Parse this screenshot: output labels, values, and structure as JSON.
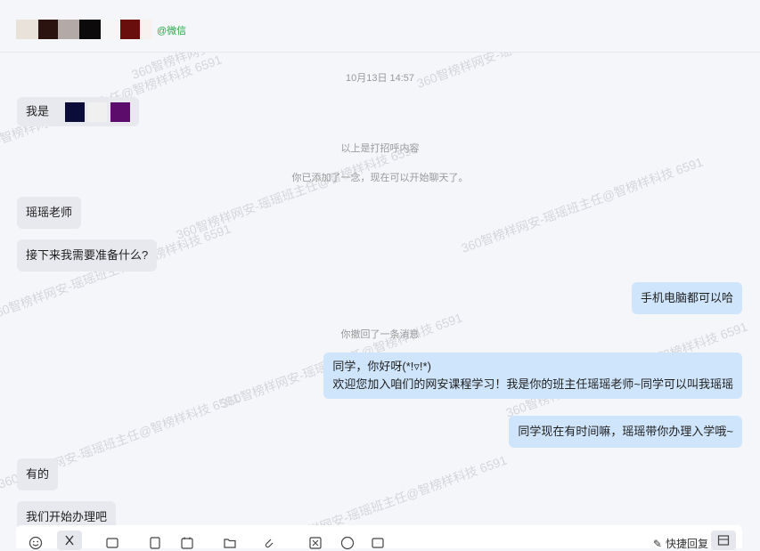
{
  "header": {
    "name_colors": [
      "#e9e2da",
      "#2b1410",
      "#b3aaa8",
      "#9b9b9b",
      "#0d0a0b",
      "#f6f6f6",
      "#6a0e0d",
      "#f7f1f0"
    ],
    "suffix": "@微信",
    "suffix_color": "#27a844"
  },
  "watermark_text": "360智榜样网安-瑶瑶班主任@智榜样科技 6591",
  "messages": {
    "timestamp": "10月13日 14:57",
    "greeting_prefix": "我是",
    "greeting_colors": [
      "#0b0c3a",
      "#f0f0f0",
      "#5c0c6a"
    ],
    "sys_greet": "以上是打招呼内容",
    "sys_added": "你已添加了一念，现在可以开始聊天了。",
    "in_teacher": "瑶瑶老师",
    "in_prepare": "接下来我需要准备什么?",
    "out_device": "手机电脑都可以哈",
    "sys_recall": "你撤回了一条消息",
    "out_hello_line1": "同学，你好呀(*!▿!*)",
    "out_hello_line2": "欢迎您加入咱们的网安课程学习！我是你的班主任瑶瑶老师~同学可以叫我瑶瑶",
    "out_time": "同学现在有时间嘛，瑶瑶带你办理入学哦~",
    "in_yes": "有的",
    "in_start": "我们开始办理吧"
  },
  "toolbar": {
    "icons": [
      "emoji-icon",
      "scissors-icon",
      "image-icon",
      "document-icon",
      "calendar-icon",
      "folder-icon",
      "attachment-icon",
      "template-icon",
      "chat-history-icon",
      "code-icon"
    ],
    "quick_reply_label": "快捷回复",
    "right_icon": "expand-icon"
  }
}
